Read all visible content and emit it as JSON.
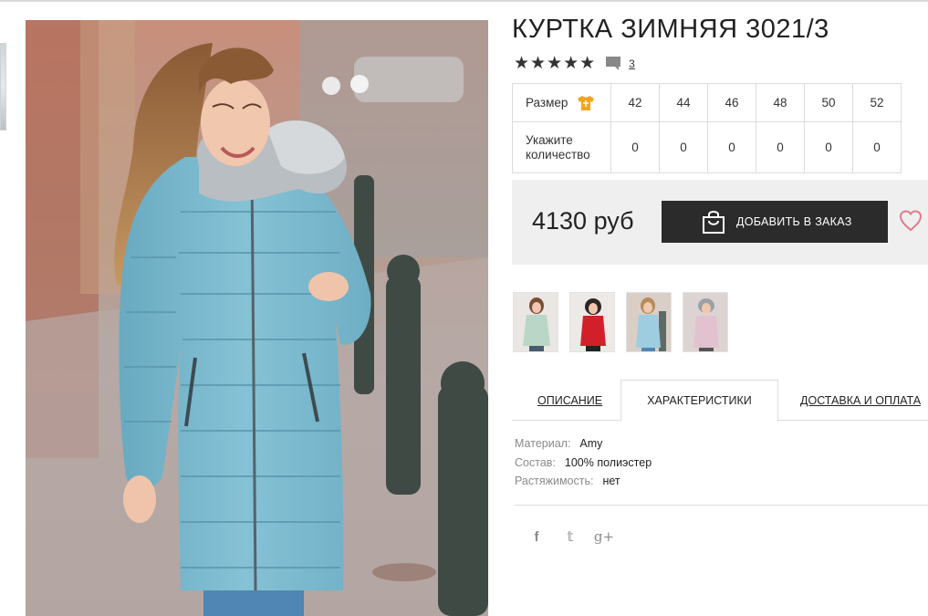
{
  "product": {
    "title": "КУРТКА ЗИМНЯЯ 3021/3",
    "stars": "★★★★★",
    "comment_count": "3"
  },
  "sizes": {
    "size_label": "Размер",
    "qty_label_1": "Укажите",
    "qty_label_2": "количество",
    "columns": [
      {
        "size": "42",
        "qty": "0"
      },
      {
        "size": "44",
        "qty": "0"
      },
      {
        "size": "46",
        "qty": "0"
      },
      {
        "size": "48",
        "qty": "0"
      },
      {
        "size": "50",
        "qty": "0"
      },
      {
        "size": "52",
        "qty": "0"
      }
    ]
  },
  "order": {
    "price": "4130 руб",
    "add_label": "ДОБАВИТЬ В ЗАКАЗ"
  },
  "tabs": {
    "description": "ОПИСАНИЕ",
    "characteristics": "ХАРАКТЕРИСТИКИ",
    "delivery": "ДОСТАВКА И ОПЛАТА"
  },
  "specs": [
    {
      "key": "Материал:",
      "value": "Amy"
    },
    {
      "key": "Состав:",
      "value": "100% полиэстер"
    },
    {
      "key": "Растяжимость:",
      "value": "нет"
    }
  ],
  "socials": {
    "facebook": "f",
    "twitter": "𝕥",
    "gplus": "g+"
  },
  "thumbnails": [
    {
      "coat_color": "#b9d6c6",
      "bg": "#e9e6e3"
    },
    {
      "coat_color": "#d2202b",
      "bg": "#ece9e7"
    },
    {
      "coat_color": "#9fcde0",
      "bg": "#d9cfc7"
    },
    {
      "coat_color": "#e3c2cf",
      "bg": "#dcd4d2"
    }
  ],
  "colors": {
    "accent_button": "#2b2b2b",
    "heart": "#e07b8c",
    "size_icon": "#f2a51a",
    "coat_main": "#7cb8cd"
  }
}
